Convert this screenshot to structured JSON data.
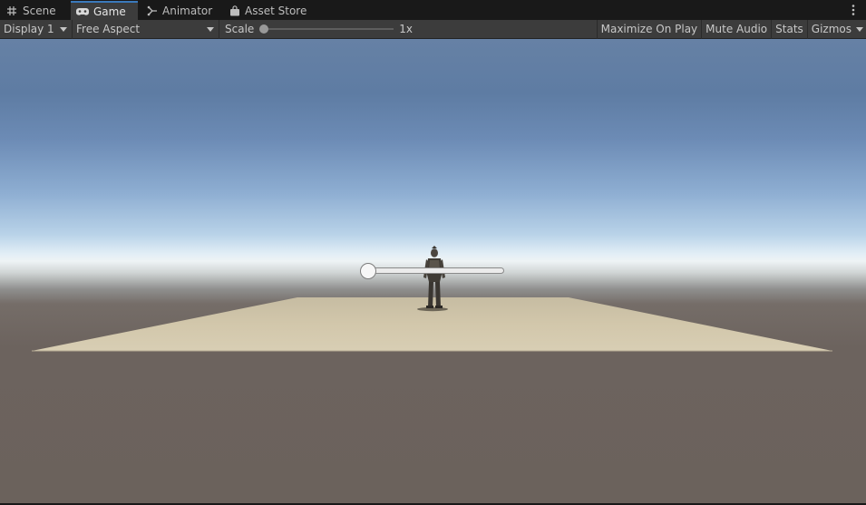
{
  "tabs": [
    {
      "label": "Scene",
      "icon": "grid-icon",
      "active": false
    },
    {
      "label": "Game",
      "icon": "gamepad-icon",
      "active": true
    },
    {
      "label": "Animator",
      "icon": "animator-icon",
      "active": false
    },
    {
      "label": "Asset Store",
      "icon": "shopping-bag-icon",
      "active": false
    }
  ],
  "toolbar": {
    "display_label": "Display 1",
    "aspect_label": "Free Aspect",
    "scale_label": "Scale",
    "scale_value": "1x",
    "scale_fraction": 0,
    "maximize_label": "Maximize On Play",
    "mute_label": "Mute Audio",
    "stats_label": "Stats",
    "gizmos_label": "Gizmos"
  },
  "game_view": {
    "ui_slider_value": 0,
    "colors": {
      "sky_top": "#5e7ca3",
      "horizon": "#eef3f5",
      "ground": "#6b625c",
      "plane": "#cfc4a8"
    }
  },
  "colors": {
    "accent": "#3a79bb",
    "panel": "#3c3c3c",
    "tabstrip": "#191919"
  }
}
